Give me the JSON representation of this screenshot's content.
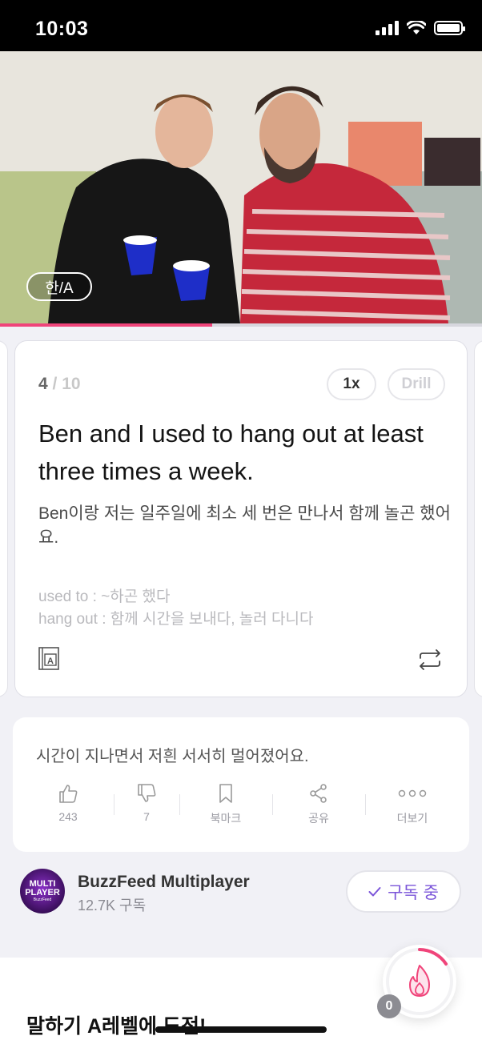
{
  "status_bar": {
    "time": "10:03"
  },
  "video": {
    "lang_toggle": "한/A",
    "progress_percent": 44
  },
  "card": {
    "current": "4",
    "total": " / 10",
    "speed": "1x",
    "drill": "Drill",
    "sentence": "Ben and I used to hang out at least three times a week.",
    "translation": "Ben이랑 저는 일주일에 최소 세 번은 만나서 함께 놀곤 했어요.",
    "vocab": [
      {
        "term": "used to",
        "meaning": " : ~하곤 했다"
      },
      {
        "term": "hang out",
        "meaning": " : 함께 시간을 보내다, 놀러 다니다"
      }
    ]
  },
  "actions": {
    "next_line": "시간이 지나면서 저흰 서서히 멀어졌어요.",
    "like": "243",
    "dislike": "7",
    "bookmark": "북마크",
    "share": "공유",
    "more": "더보기"
  },
  "channel": {
    "avatar_line1": "MULTI",
    "avatar_line2": "PLAYER",
    "avatar_line3": "BuzzFeed",
    "name": "BuzzFeed Multiplayer",
    "subscribers": "12.7K 구독",
    "subscribe_label": "구독 중"
  },
  "bottom": {
    "title": "말하기 A레벨에 도전!",
    "fire_count": "0"
  },
  "colors": {
    "accent": "#f0447a",
    "subscribe": "#7b55d9"
  }
}
